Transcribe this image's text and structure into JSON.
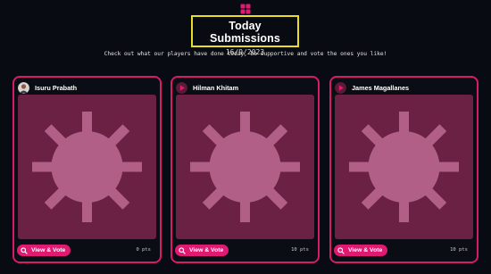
{
  "header": {
    "title": "Today Submissions",
    "date": "16/9/2023",
    "subtitle": "Check out what our players have done today, be supportive and vote the ones you like!"
  },
  "colors": {
    "accent": "#d81b69",
    "button": "#e01a73",
    "highlight_border": "#e9dd2a",
    "image_bg": "#6b2144",
    "image_fg": "#b25f88",
    "background": "#080b12"
  },
  "cards": [
    {
      "name": "Isuru Prabath",
      "button_label": "View & Vote",
      "points": "0 pts",
      "avatar": "user-photo",
      "image_icon": "sun-placeholder-icon"
    },
    {
      "name": "Hilman Khitam",
      "button_label": "View & Vote",
      "points": "10 pts",
      "avatar": "play-avatar-icon",
      "image_icon": "sun-placeholder-icon"
    },
    {
      "name": "James Magallanes",
      "button_label": "View & Vote",
      "points": "10 pts",
      "avatar": "play-avatar-icon",
      "image_icon": "sun-placeholder-icon"
    }
  ]
}
